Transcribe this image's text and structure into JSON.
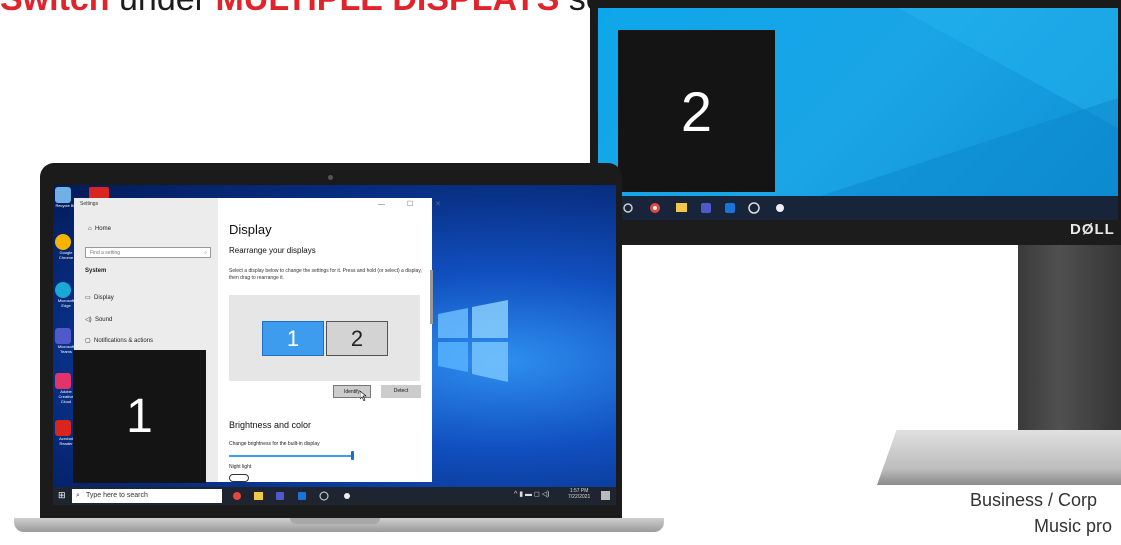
{
  "caption": {
    "part1": "Switch",
    "part2": " under ",
    "part3": "MULTIPLE DISPLAYS",
    "part4": " section."
  },
  "monitor": {
    "identify_number": "2",
    "brand": "DØLL"
  },
  "credits": {
    "line1": "Business / Corp",
    "line2": "Music pro"
  },
  "laptop": {
    "identify_number": "1",
    "taskbar": {
      "search_placeholder": "Type here to search",
      "start_glyph": "⊞",
      "time": "1:57 PM",
      "date": "7/22/2021",
      "tray": "^ ▮ ▬ ◻ ◁)"
    },
    "desktop_icons": [
      {
        "label": "Recycle Bin",
        "color": "#6fb1e6"
      },
      {
        "label": "Google Chrome",
        "color": "#f4b400"
      },
      {
        "label": "Microsoft Edge",
        "color": "#1aa8d6"
      },
      {
        "label": "Microsoft Teams",
        "color": "#5059c9"
      },
      {
        "label": "Adobe Creative Cloud",
        "color": "#e2336b"
      },
      {
        "label": "Acrobat Reader",
        "color": "#d8261f"
      }
    ]
  },
  "settings": {
    "window_title": "Settings",
    "window_controls": "— ☐ ✕",
    "home": "Home",
    "find_placeholder": "Find a setting",
    "section": "System",
    "nav": [
      "Display",
      "Sound",
      "Notifications & actions"
    ],
    "page_title": "Display",
    "rearrange_heading": "Rearrange your displays",
    "rearrange_desc": "Select a display below to change the settings for it. Press and hold (or select) a display, then drag to rearrange it.",
    "display_tiles": [
      "1",
      "2"
    ],
    "identify_button": "Identify",
    "detect_button": "Detect",
    "brightness_heading": "Brightness and color",
    "brightness_label": "Change brightness for the built-in display",
    "night_light_label": "Night light"
  },
  "colors": {
    "caption_red": "#e0242b",
    "accent": "#3e9cee"
  }
}
